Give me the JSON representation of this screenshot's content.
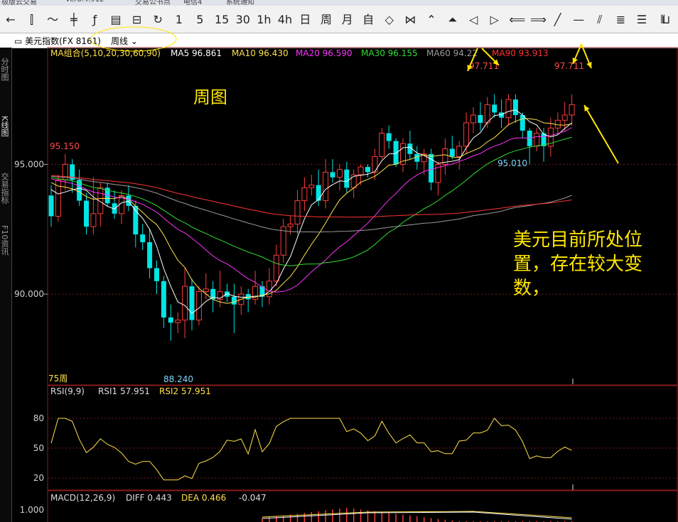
{
  "titlebar": {
    "items": [
      "极版云交易",
      "Ver8.4.912",
      "交易公书点",
      "电信4",
      "系统通知"
    ]
  },
  "toolbar": {
    "buttons": [
      {
        "name": "back-button",
        "glyph": "←"
      },
      {
        "name": "candlestick-button",
        "glyph": "⫿"
      },
      {
        "name": "line-chart-button",
        "glyph": "〜"
      },
      {
        "name": "bar-type-button",
        "glyph": "╪"
      },
      {
        "name": "formula-button",
        "glyph": "ƒ"
      },
      {
        "name": "indicator-button",
        "glyph": "▤"
      },
      {
        "name": "save-button",
        "glyph": "⊟"
      },
      {
        "name": "refresh-button",
        "glyph": "↻"
      },
      {
        "name": "period-1min",
        "glyph": "1"
      },
      {
        "name": "period-5min",
        "glyph": "5"
      },
      {
        "name": "period-15min",
        "glyph": "15"
      },
      {
        "name": "period-30min",
        "glyph": "30"
      },
      {
        "name": "period-1h",
        "glyph": "1h"
      },
      {
        "name": "period-4h",
        "glyph": "4h"
      },
      {
        "name": "period-day",
        "glyph": "日"
      },
      {
        "name": "period-week",
        "glyph": "周"
      },
      {
        "name": "period-month",
        "glyph": "月"
      },
      {
        "name": "period-custom",
        "glyph": "自"
      },
      {
        "name": "zoom-in-button",
        "glyph": "◇"
      },
      {
        "name": "zoom-out-button",
        "glyph": "⋈"
      },
      {
        "name": "scroll-up-button",
        "glyph": "⌃"
      },
      {
        "name": "scroll-top-button",
        "glyph": "⏶"
      },
      {
        "name": "scroll-left-button",
        "glyph": "◁"
      },
      {
        "name": "scroll-right-button",
        "glyph": "▷"
      },
      {
        "name": "pan-left-button",
        "glyph": "⟸"
      },
      {
        "name": "pan-right-button",
        "glyph": "⟹"
      },
      {
        "name": "draw-line-button",
        "glyph": "╱"
      },
      {
        "name": "draw-hline-button",
        "glyph": "—"
      },
      {
        "name": "draw-parallel-button",
        "glyph": "⫽"
      },
      {
        "name": "fib-button",
        "glyph": "≣"
      },
      {
        "name": "channel-button",
        "glyph": "☰"
      },
      {
        "name": "gann-button",
        "glyph": "⦀"
      },
      {
        "name": "more-tools-button",
        "glyph": "⊔"
      }
    ]
  },
  "infobar": {
    "symbol": "▭ 美元指数(FX 8161)",
    "period": "周线"
  },
  "sidebar": {
    "tabs": [
      "分时图",
      "K线图",
      "交易指标",
      "F10资讯"
    ]
  },
  "legend": {
    "ma_group": "MA组合(5,10,20,30,60,90)",
    "items": [
      {
        "label": "MA5 96.861",
        "color": "#ffffff"
      },
      {
        "label": "MA10 96.430",
        "color": "#ffe14a"
      },
      {
        "label": "MA20 96.590",
        "color": "#ff33ff"
      },
      {
        "label": "MA30 96.155",
        "color": "#33dd33"
      },
      {
        "label": "MA60 94.22",
        "color": "#9a9a9a"
      },
      {
        "label": "MA90 93.913",
        "color": "#ff3333"
      }
    ]
  },
  "annotations": {
    "week_chart": "周图",
    "comment_lines": [
      "美元目前所处位",
      "置，存在较大变",
      "数，"
    ],
    "high_left": "97.711",
    "high_right": "97.711",
    "level_95150": "95.150",
    "low_95010": "95.010",
    "low_88240": "88.240",
    "period_count": "75周"
  },
  "axis": {
    "ticks": [
      "95.000",
      "90.000"
    ]
  },
  "rsi": {
    "title": "RSI(9,9)",
    "rsi1": "RSI1 57.951",
    "rsi2": "RSI2 57.951",
    "ticks": [
      "80",
      "50",
      "20"
    ]
  },
  "macd": {
    "title": "MACD(12,26,9)",
    "diff": "DIFF 0.443",
    "dea": "DEA 0.466",
    "macd": "-0.047",
    "tick": "1.000"
  },
  "colors": {
    "up": "#ff3b3b",
    "down": "#00e5e5",
    "annotation": "#ffe600",
    "grid": "#7a1a1a"
  },
  "chart_data": {
    "type": "candlestick",
    "period": "weekly",
    "ylim": [
      86.5,
      99.5
    ],
    "candles": [
      [
        93.8,
        94.2,
        92.6,
        93.0
      ],
      [
        93.0,
        94.6,
        92.8,
        94.4
      ],
      [
        94.4,
        95.4,
        94.0,
        95.0
      ],
      [
        95.0,
        95.2,
        93.9,
        94.4
      ],
      [
        94.4,
        94.8,
        93.4,
        93.6
      ],
      [
        93.6,
        93.9,
        92.3,
        92.6
      ],
      [
        92.6,
        94.5,
        92.3,
        93.1
      ],
      [
        93.1,
        94.3,
        92.6,
        94.1
      ],
      [
        94.1,
        94.3,
        93.4,
        93.5
      ],
      [
        93.5,
        94.0,
        92.9,
        93.1
      ],
      [
        93.1,
        94.0,
        92.7,
        93.8
      ],
      [
        93.8,
        94.2,
        93.2,
        93.4
      ],
      [
        93.4,
        93.6,
        91.8,
        92.3
      ],
      [
        92.3,
        92.7,
        91.7,
        92.0
      ],
      [
        92.0,
        92.5,
        90.6,
        91.0
      ],
      [
        91.0,
        91.3,
        90.0,
        90.5
      ],
      [
        90.5,
        90.7,
        88.7,
        89.1
      ],
      [
        89.1,
        89.6,
        88.2,
        88.9
      ],
      [
        88.9,
        89.3,
        88.5,
        89.0
      ],
      [
        89.0,
        91.0,
        88.3,
        90.3
      ],
      [
        90.3,
        90.6,
        88.6,
        89.0
      ],
      [
        89.0,
        90.3,
        88.8,
        90.1
      ],
      [
        90.1,
        90.8,
        89.8,
        90.2
      ],
      [
        90.2,
        90.5,
        89.3,
        89.8
      ],
      [
        89.8,
        90.9,
        89.5,
        90.1
      ],
      [
        90.1,
        90.4,
        89.7,
        89.9
      ],
      [
        89.9,
        90.4,
        88.5,
        89.6
      ],
      [
        89.6,
        90.3,
        89.2,
        90.0
      ],
      [
        90.0,
        90.2,
        89.3,
        89.8
      ],
      [
        89.8,
        90.9,
        89.6,
        90.3
      ],
      [
        90.3,
        90.5,
        89.5,
        89.9
      ],
      [
        89.9,
        91.0,
        89.6,
        90.5
      ],
      [
        90.5,
        91.9,
        90.3,
        91.5
      ],
      [
        91.5,
        92.9,
        91.2,
        92.6
      ],
      [
        92.6,
        93.0,
        92.3,
        92.7
      ],
      [
        92.7,
        94.0,
        92.3,
        93.6
      ],
      [
        93.6,
        94.5,
        93.2,
        94.1
      ],
      [
        94.1,
        94.6,
        93.8,
        94.2
      ],
      [
        94.2,
        94.8,
        93.4,
        93.6
      ],
      [
        93.6,
        95.2,
        93.3,
        94.7
      ],
      [
        94.7,
        95.2,
        94.3,
        94.5
      ],
      [
        94.5,
        95.0,
        94.0,
        94.8
      ],
      [
        94.8,
        95.1,
        93.9,
        94.1
      ],
      [
        94.1,
        94.8,
        93.7,
        94.6
      ],
      [
        94.6,
        95.0,
        94.2,
        94.9
      ],
      [
        94.9,
        95.0,
        94.5,
        94.7
      ],
      [
        94.7,
        95.6,
        94.4,
        95.3
      ],
      [
        95.3,
        96.4,
        95.2,
        96.2
      ],
      [
        96.2,
        96.5,
        95.6,
        95.9
      ],
      [
        95.9,
        96.0,
        94.9,
        95.0
      ],
      [
        95.0,
        96.0,
        94.7,
        95.8
      ],
      [
        95.8,
        96.3,
        95.2,
        95.4
      ],
      [
        95.4,
        95.7,
        94.8,
        95.1
      ],
      [
        95.1,
        95.6,
        94.6,
        95.4
      ],
      [
        95.4,
        95.6,
        94.0,
        94.3
      ],
      [
        94.3,
        95.1,
        93.8,
        95.0
      ],
      [
        95.0,
        96.0,
        94.6,
        95.6
      ],
      [
        95.6,
        96.1,
        95.2,
        95.3
      ],
      [
        95.3,
        95.9,
        94.8,
        95.7
      ],
      [
        95.7,
        97.0,
        95.4,
        96.6
      ],
      [
        96.6,
        97.2,
        96.2,
        96.9
      ],
      [
        96.9,
        97.4,
        96.3,
        96.6
      ],
      [
        96.6,
        97.6,
        96.4,
        97.3
      ],
      [
        97.3,
        97.7,
        96.8,
        97.0
      ],
      [
        97.0,
        97.5,
        96.4,
        96.8
      ],
      [
        96.8,
        97.7,
        96.5,
        97.5
      ],
      [
        97.5,
        97.7,
        96.6,
        96.9
      ],
      [
        96.9,
        97.0,
        96.0,
        96.3
      ],
      [
        96.3,
        96.4,
        95.0,
        95.7
      ],
      [
        95.7,
        96.4,
        95.5,
        96.2
      ],
      [
        96.2,
        96.4,
        95.1,
        95.7
      ],
      [
        95.7,
        96.8,
        95.3,
        96.4
      ],
      [
        96.4,
        97.0,
        96.2,
        96.7
      ],
      [
        96.7,
        97.4,
        96.3,
        96.9
      ],
      [
        96.9,
        97.7,
        96.5,
        97.3
      ]
    ],
    "rsi_range": [
      0,
      100
    ]
  }
}
